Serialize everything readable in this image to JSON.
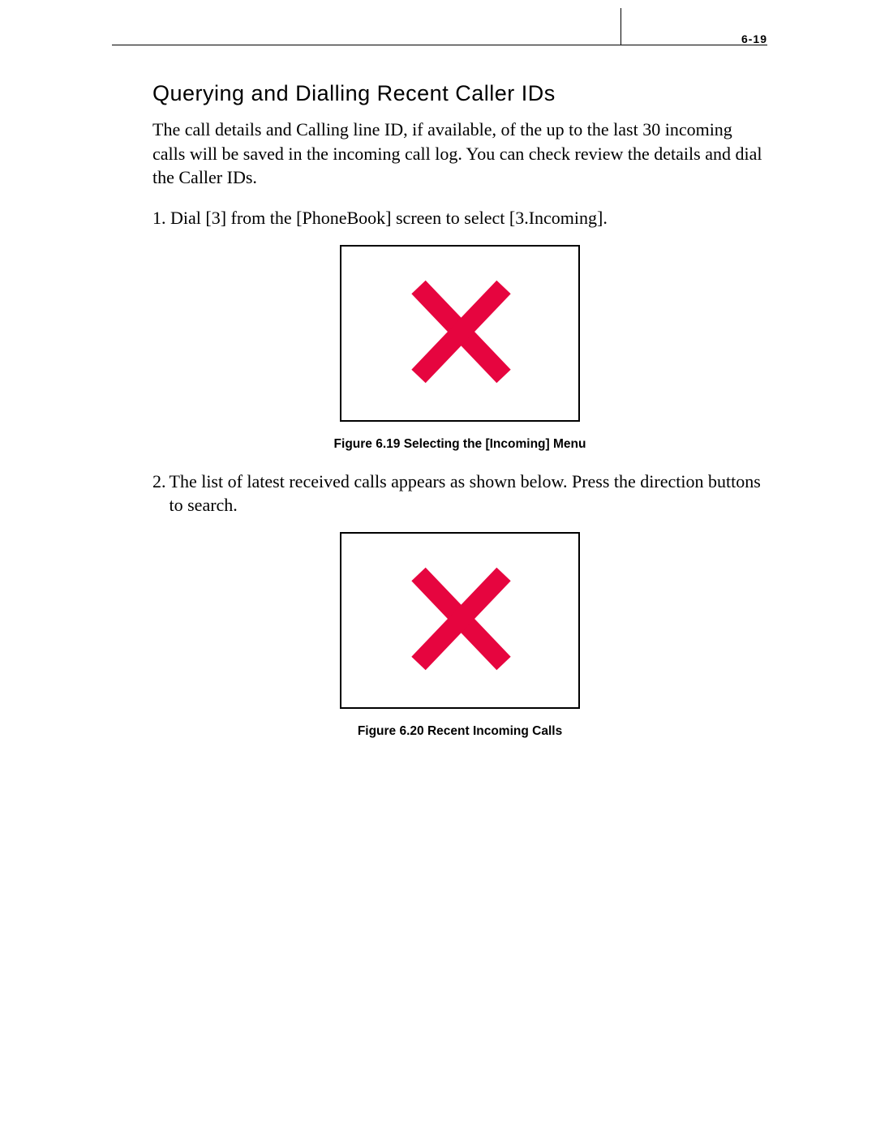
{
  "header": {
    "page_number": "6-19"
  },
  "section": {
    "title": "Querying and Dialling Recent Caller IDs",
    "intro": "The call details and Calling line ID, if available, of the up to the last 30 incoming calls will be saved in the incoming call log. You can check review the details and dial the Caller IDs.",
    "step1": "1. Dial [3] from the [PhoneBook] screen to select [3.Incoming].",
    "figure1_caption": "Figure 6.19  Selecting the [Incoming] Menu",
    "step2_number": "2.  ",
    "step2_body": "The list of latest received calls appears as shown below. Press the direction buttons to search.",
    "figure2_caption": "Figure 6.20  Recent Incoming Calls"
  },
  "icons": {
    "placeholder_color": "#e6053f"
  }
}
